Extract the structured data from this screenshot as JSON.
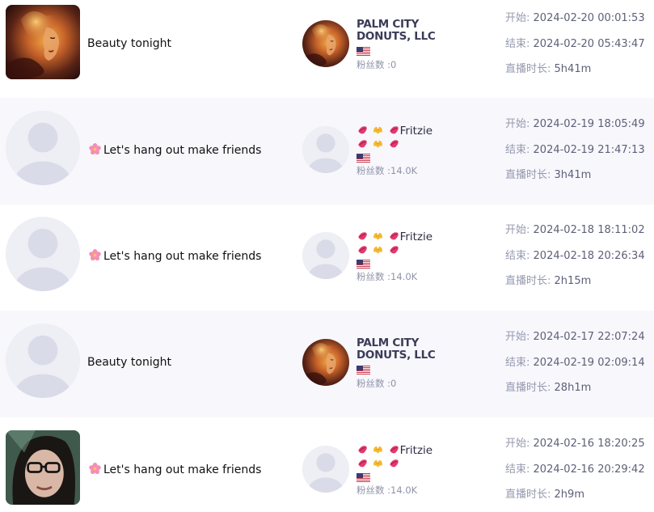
{
  "rows": [
    {
      "title": "Beauty tonight",
      "title_has_flower": false,
      "thumb": "fire-portrait",
      "host_avatar": "fire-portrait",
      "host_name_line1": "PALM CITY",
      "host_name_line2": "DONUTS, LLC",
      "host_emoji": false,
      "flag": "us-flag-icon",
      "fans_label": "粉丝数 :",
      "fans": "0",
      "start_label": "开始:",
      "start": "2024-02-20 00:01:53",
      "end_label": "结束:",
      "end": "2024-02-20 05:43:47",
      "duration_label": "直播时长:",
      "duration": "5h41m"
    },
    {
      "title": "Let's hang out make friends",
      "title_has_flower": true,
      "thumb": "placeholder",
      "host_avatar": "placeholder",
      "host_name_line1": "Fritzie",
      "host_name_line2": "",
      "host_emoji": true,
      "flag": "us-flag-icon",
      "fans_label": "粉丝数 :",
      "fans": "14.0K",
      "start_label": "开始:",
      "start": "2024-02-19 18:05:49",
      "end_label": "结束:",
      "end": "2024-02-19 21:47:13",
      "duration_label": "直播时长:",
      "duration": "3h41m"
    },
    {
      "title": "Let's hang out make friends",
      "title_has_flower": true,
      "thumb": "placeholder",
      "host_avatar": "placeholder",
      "host_name_line1": "Fritzie",
      "host_name_line2": "",
      "host_emoji": true,
      "flag": "us-flag-icon",
      "fans_label": "粉丝数 :",
      "fans": "14.0K",
      "start_label": "开始:",
      "start": "2024-02-18 18:11:02",
      "end_label": "结束:",
      "end": "2024-02-18 20:26:34",
      "duration_label": "直播时长:",
      "duration": "2h15m"
    },
    {
      "title": "Beauty tonight",
      "title_has_flower": false,
      "thumb": "placeholder",
      "host_avatar": "fire-portrait",
      "host_name_line1": "PALM CITY",
      "host_name_line2": "DONUTS, LLC",
      "host_emoji": false,
      "flag": "us-flag-icon",
      "fans_label": "粉丝数 :",
      "fans": "0",
      "start_label": "开始:",
      "start": "2024-02-17 22:07:24",
      "end_label": "结束:",
      "end": "2024-02-19 02:09:14",
      "duration_label": "直播时长:",
      "duration": "28h1m"
    },
    {
      "title": "Let's hang out make friends",
      "title_has_flower": true,
      "thumb": "glasses-portrait",
      "host_avatar": "placeholder",
      "host_name_line1": "Fritzie",
      "host_name_line2": "",
      "host_emoji": true,
      "flag": "us-flag-icon",
      "fans_label": "粉丝数 :",
      "fans": "14.0K",
      "start_label": "开始:",
      "start": "2024-02-16 18:20:25",
      "end_label": "结束:",
      "end": "2024-02-16 20:29:42",
      "duration_label": "直播时长:",
      "duration": "2h9m"
    }
  ],
  "colors": {
    "alt_row_bg": "#f7f7fc",
    "placeholder_bg": "#eeeef5",
    "placeholder_shape": "#d9dbe8",
    "label": "#9599ae",
    "value": "#5d6078"
  }
}
